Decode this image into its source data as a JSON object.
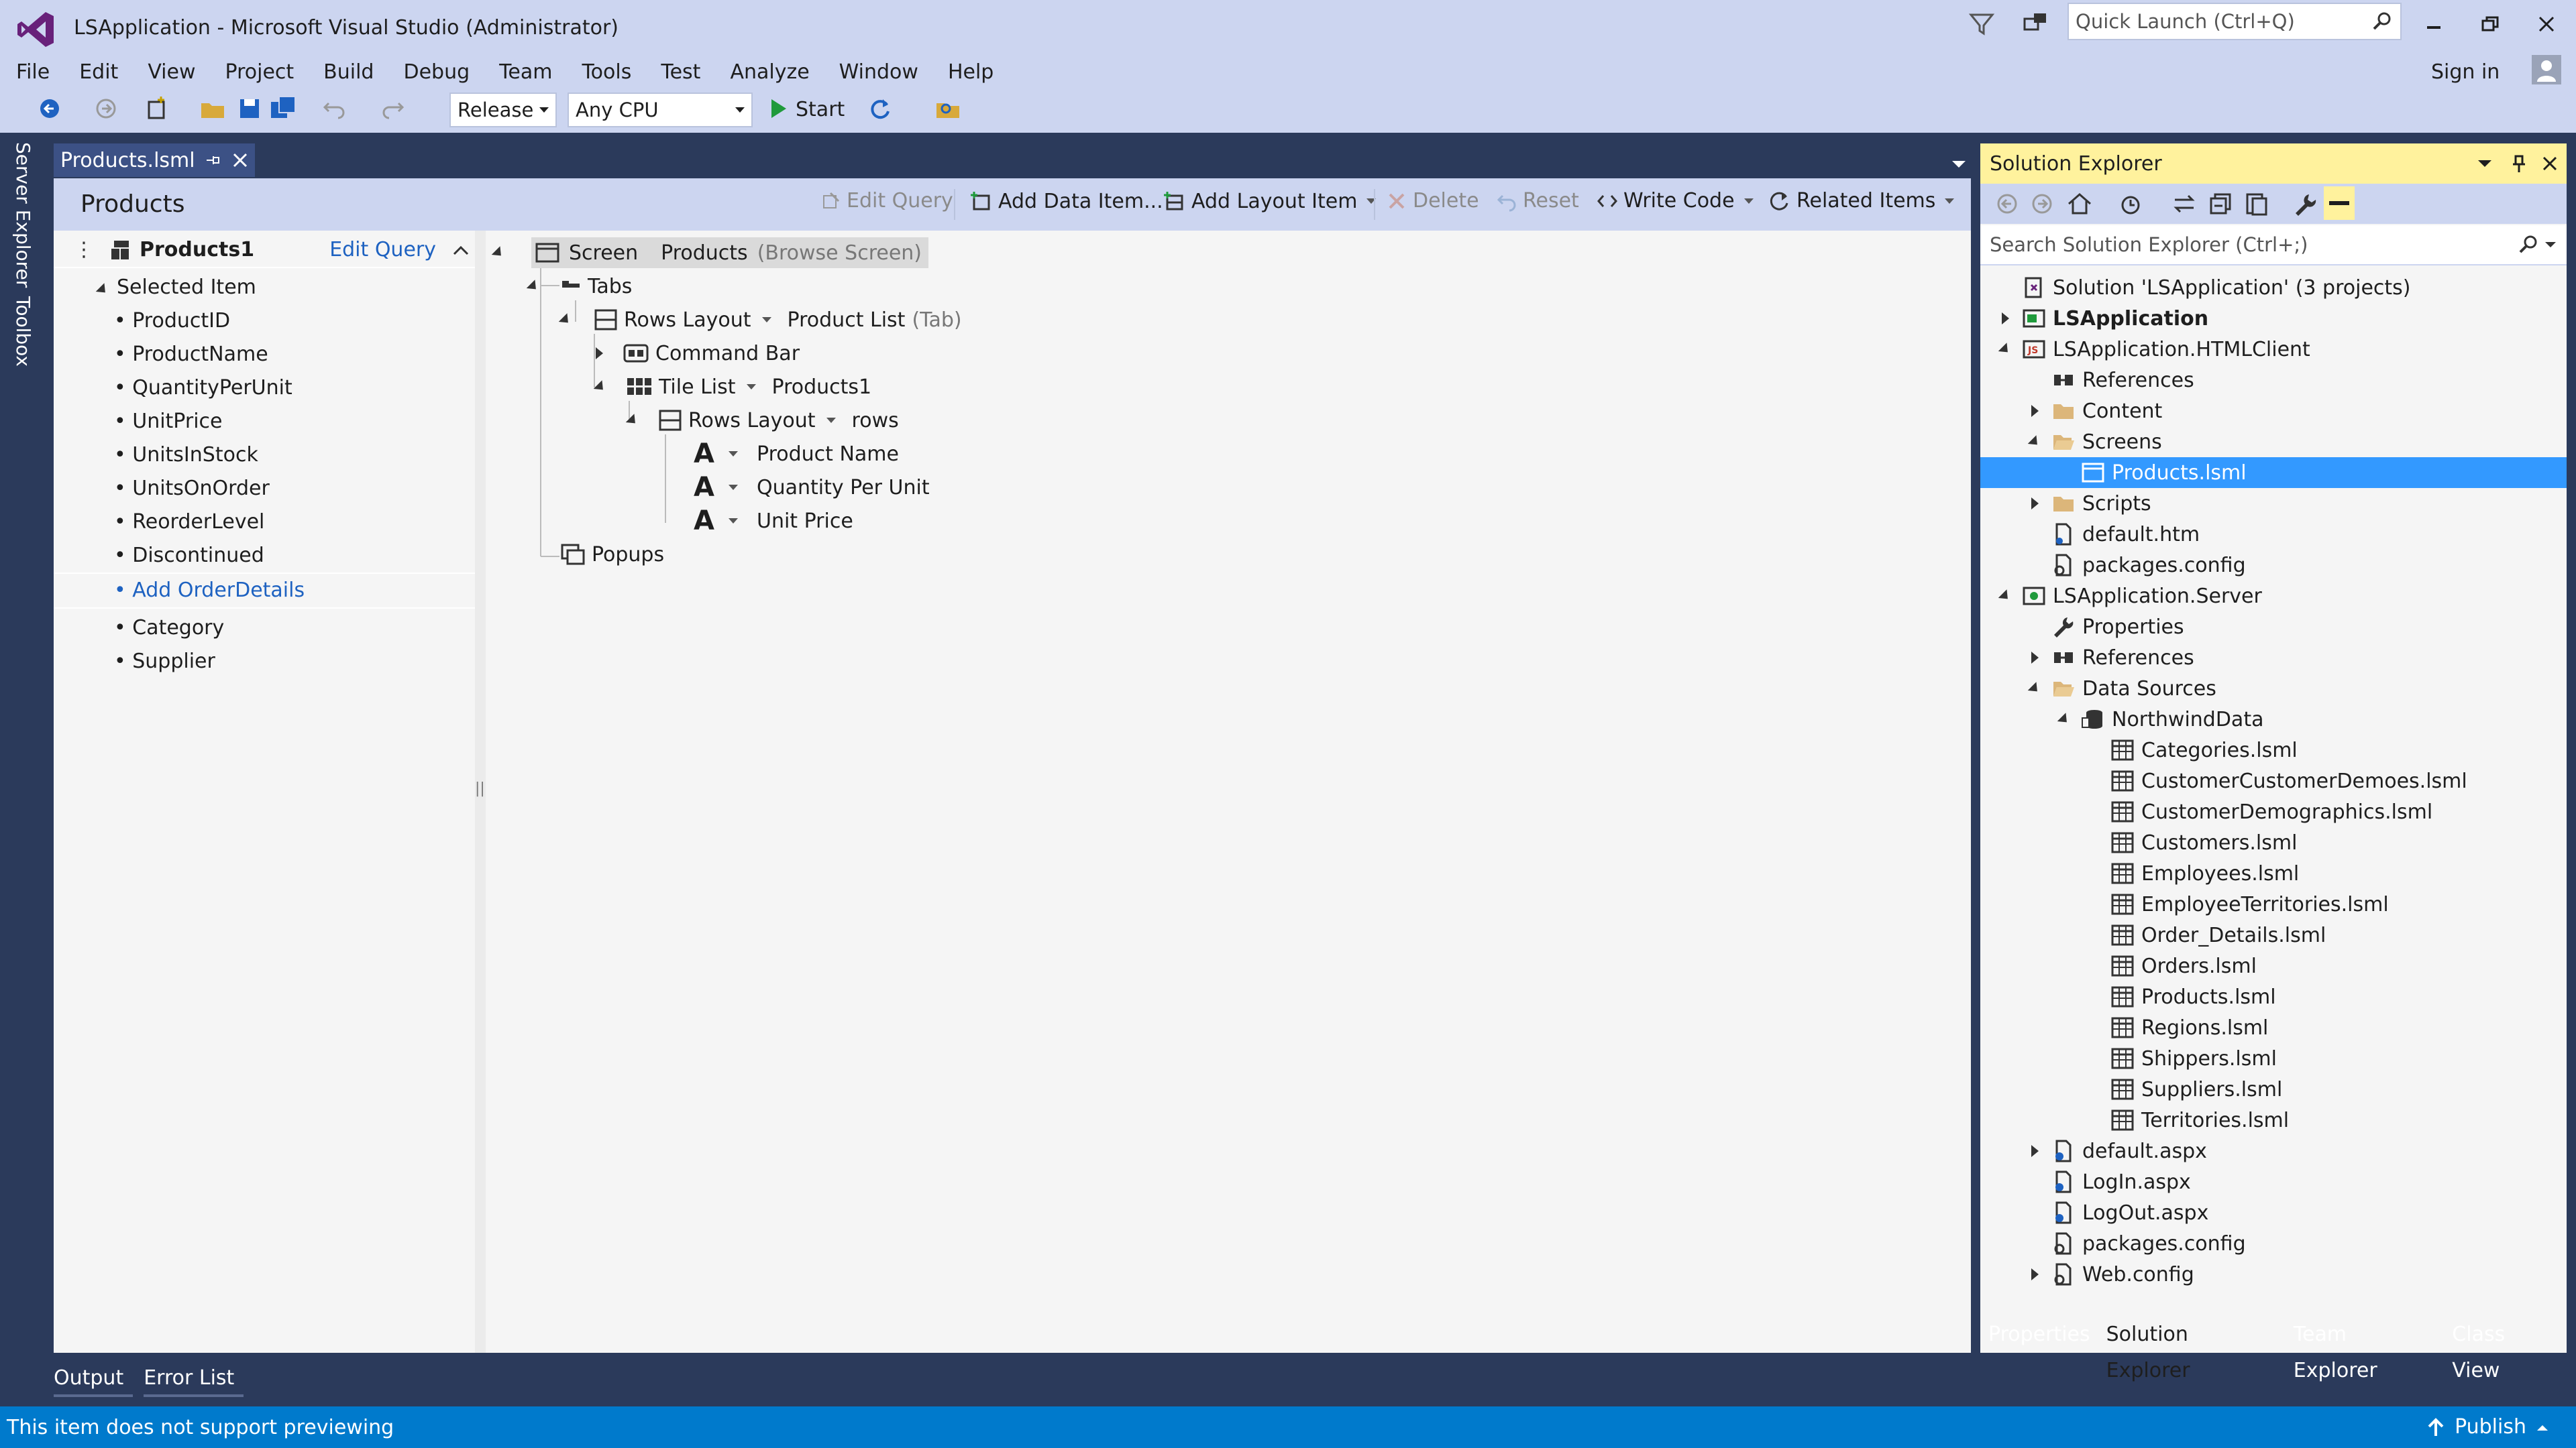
{
  "window": {
    "title": "LSApplication - Microsoft Visual Studio (Administrator)",
    "quick_launch_placeholder": "Quick Launch (Ctrl+Q)",
    "sign_in": "Sign in"
  },
  "menu": [
    "File",
    "Edit",
    "View",
    "Project",
    "Build",
    "Debug",
    "Team",
    "Tools",
    "Test",
    "Analyze",
    "Window",
    "Help"
  ],
  "toolbar": {
    "configuration": "Release",
    "platform": "Any CPU",
    "start": "Start"
  },
  "side_tabs": [
    "Server Explorer",
    "Toolbox"
  ],
  "document_tab": "Products.lsml",
  "designer": {
    "title": "Products",
    "tools": {
      "edit_query": "Edit Query",
      "add_data_item": "Add Data Item...",
      "add_layout_item": "Add Layout Item",
      "delete": "Delete",
      "reset": "Reset",
      "write_code": "Write Code",
      "related_items": "Related Items"
    },
    "left": {
      "collection": "Products1",
      "edit_query": "Edit Query",
      "selected_item": "Selected Item",
      "fields": [
        "ProductID",
        "ProductName",
        "QuantityPerUnit",
        "UnitPrice",
        "UnitsInStock",
        "UnitsOnOrder",
        "ReorderLevel",
        "Discontinued"
      ],
      "add_link": "Add OrderDetails",
      "nav": [
        "Category",
        "Supplier"
      ]
    },
    "tree": {
      "screen": "Screen",
      "screen_name": "Products",
      "screen_type": "(Browse Screen)",
      "tabs": "Tabs",
      "rows_layout": "Rows Layout",
      "product_list": "Product List",
      "tab_hint": "(Tab)",
      "command_bar": "Command Bar",
      "tile_list": "Tile List",
      "products1": "Products1",
      "rows_layout_inner": "Rows Layout",
      "rows": "rows",
      "fields": [
        "Product Name",
        "Quantity Per Unit",
        "Unit Price"
      ],
      "popups": "Popups"
    }
  },
  "solution_explorer": {
    "title": "Solution Explorer",
    "search_placeholder": "Search Solution Explorer (Ctrl+;)",
    "rows": [
      {
        "label": "Solution 'LSApplication' (3 projects)",
        "level": 0,
        "exp": "",
        "icon": "solution-icon"
      },
      {
        "label": "LSApplication",
        "level": 0,
        "exp": "right",
        "icon": "project-icon",
        "bold": true
      },
      {
        "label": "LSApplication.HTMLClient",
        "level": 0,
        "exp": "down",
        "icon": "js-project-icon"
      },
      {
        "label": "References",
        "level": 1,
        "exp": "",
        "icon": "references-icon"
      },
      {
        "label": "Content",
        "level": 1,
        "exp": "right",
        "icon": "folder-icon"
      },
      {
        "label": "Screens",
        "level": 1,
        "exp": "down",
        "icon": "folder-open-icon"
      },
      {
        "label": "Products.lsml",
        "level": 2,
        "exp": "",
        "icon": "screen-file-icon",
        "selected": true
      },
      {
        "label": "Scripts",
        "level": 1,
        "exp": "right",
        "icon": "folder-icon"
      },
      {
        "label": "default.htm",
        "level": 1,
        "exp": "",
        "icon": "html-file-icon"
      },
      {
        "label": "packages.config",
        "level": 1,
        "exp": "",
        "icon": "config-file-icon"
      },
      {
        "label": "LSApplication.Server",
        "level": 0,
        "exp": "down",
        "icon": "server-project-icon"
      },
      {
        "label": "Properties",
        "level": 1,
        "exp": "",
        "icon": "wrench-icon"
      },
      {
        "label": "References",
        "level": 1,
        "exp": "right",
        "icon": "references-icon"
      },
      {
        "label": "Data Sources",
        "level": 1,
        "exp": "down",
        "icon": "folder-open-icon"
      },
      {
        "label": "NorthwindData",
        "level": 2,
        "exp": "down",
        "icon": "database-icon"
      },
      {
        "label": "Categories.lsml",
        "level": 3,
        "exp": "",
        "icon": "table-icon"
      },
      {
        "label": "CustomerCustomerDemoes.lsml",
        "level": 3,
        "exp": "",
        "icon": "table-icon"
      },
      {
        "label": "CustomerDemographics.lsml",
        "level": 3,
        "exp": "",
        "icon": "table-icon"
      },
      {
        "label": "Customers.lsml",
        "level": 3,
        "exp": "",
        "icon": "table-icon"
      },
      {
        "label": "Employees.lsml",
        "level": 3,
        "exp": "",
        "icon": "table-icon"
      },
      {
        "label": "EmployeeTerritories.lsml",
        "level": 3,
        "exp": "",
        "icon": "table-icon"
      },
      {
        "label": "Order_Details.lsml",
        "level": 3,
        "exp": "",
        "icon": "table-icon"
      },
      {
        "label": "Orders.lsml",
        "level": 3,
        "exp": "",
        "icon": "table-icon"
      },
      {
        "label": "Products.lsml",
        "level": 3,
        "exp": "",
        "icon": "table-icon"
      },
      {
        "label": "Regions.lsml",
        "level": 3,
        "exp": "",
        "icon": "table-icon"
      },
      {
        "label": "Shippers.lsml",
        "level": 3,
        "exp": "",
        "icon": "table-icon"
      },
      {
        "label": "Suppliers.lsml",
        "level": 3,
        "exp": "",
        "icon": "table-icon"
      },
      {
        "label": "Territories.lsml",
        "level": 3,
        "exp": "",
        "icon": "table-icon"
      },
      {
        "label": "default.aspx",
        "level": 1,
        "exp": "right",
        "icon": "aspx-file-icon"
      },
      {
        "label": "LogIn.aspx",
        "level": 1,
        "exp": "",
        "icon": "aspx-file-icon"
      },
      {
        "label": "LogOut.aspx",
        "level": 1,
        "exp": "",
        "icon": "aspx-file-icon"
      },
      {
        "label": "packages.config",
        "level": 1,
        "exp": "",
        "icon": "config-file-icon"
      },
      {
        "label": "Web.config",
        "level": 1,
        "exp": "right",
        "icon": "config-file-icon"
      }
    ],
    "tabs": [
      "Properties",
      "Solution Explorer",
      "Team Explorer",
      "Class View"
    ],
    "active_tab": "Solution Explorer"
  },
  "bottom_tabs": [
    "Output",
    "Error List"
  ],
  "status": {
    "message": "This item does not support previewing",
    "publish": "Publish"
  },
  "colors": {
    "accent": "#007acc",
    "selection": "#3399ff",
    "panel_header": "#fff29d",
    "chrome": "#ccd5f0",
    "dark": "#2b3a5b"
  }
}
